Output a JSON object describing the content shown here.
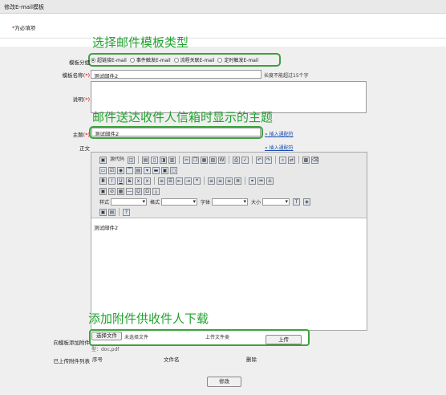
{
  "window": {
    "title": "修改E-mail模板"
  },
  "required_note": {
    "star": "*",
    "text": "为必填项"
  },
  "annotations": {
    "type": "选择邮件模板类型",
    "subject": "邮件送达收件人信箱时显示的主题",
    "attach": "添加附件供收件人下载"
  },
  "form": {
    "group_label": "模板分组",
    "group_options": [
      {
        "label": "超链接E-mail",
        "checked": true
      },
      {
        "label": "事件触发E-mail",
        "checked": false
      },
      {
        "label": "流程关联E-mail",
        "checked": false
      },
      {
        "label": "定时触发E-mail",
        "checked": false
      }
    ],
    "name_label": "模板名称",
    "name_star": "(*)",
    "name_value": "测试邮件2",
    "name_hint": "长度不能超过15个字",
    "desc_label": "说明",
    "desc_star": "(*)",
    "subject_label": "主题",
    "subject_star": "(*)",
    "subject_value": "测试邮件2",
    "insert_placeholder": "» 插入通配符",
    "body_label": "正文",
    "body_insert": "» 插入通配符",
    "body_text": "测试邮件2",
    "attach_label": "向模板添加附件",
    "choose_file": "选择文件",
    "no_file": "未选择文件",
    "upload_type_label": "上传文件类",
    "upload_type_rest": "型：doc,pdf",
    "upload_button": "上传",
    "uploaded_label": "已上传附件列表",
    "table_headers": [
      "序号",
      "文件名",
      "删除"
    ],
    "submit": "修改"
  },
  "toolbar": {
    "source": "源代码",
    "style": "样式",
    "format": "格式",
    "font": "字体",
    "size": "大小"
  }
}
